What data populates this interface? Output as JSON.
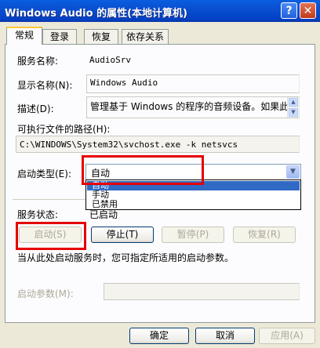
{
  "window": {
    "title": "Windows Audio 的属性(本地计算机)",
    "help_label": "?",
    "close_label": "✕"
  },
  "tabs": [
    {
      "label": "常规"
    },
    {
      "label": "登录"
    },
    {
      "label": "恢复"
    },
    {
      "label": "依存关系"
    }
  ],
  "general": {
    "service_name_label": "服务名称:",
    "service_name": "AudioSrv",
    "display_name_label": "显示名称(N):",
    "display_name": "Windows Audio",
    "description_label": "描述(D):",
    "description": "管理基于 Windows 的程序的音频设备。如果此",
    "exe_path_label": "可执行文件的路径(H):",
    "exe_path": "C:\\WINDOWS\\System32\\svchost.exe -k netsvcs",
    "startup_type_label": "启动类型(E):",
    "startup_type": "自动",
    "startup_options": [
      "自动",
      "手动",
      "已禁用"
    ],
    "service_status_label": "服务状态:",
    "service_status": "已启动",
    "start_label": "启动(S)",
    "stop_label": "停止(T)",
    "pause_label": "暂停(P)",
    "resume_label": "恢复(R)",
    "hint": "当从此处启动服务时，您可指定所适用的启动参数。",
    "start_params_label": "启动参数(M):",
    "start_params": ""
  },
  "footer": {
    "ok_label": "确定",
    "cancel_label": "取消",
    "apply_label": "应用(A)"
  },
  "colors": {
    "title_bar": "#0a4fd0",
    "highlight": "#316ac5",
    "annotation": "#e60000"
  }
}
